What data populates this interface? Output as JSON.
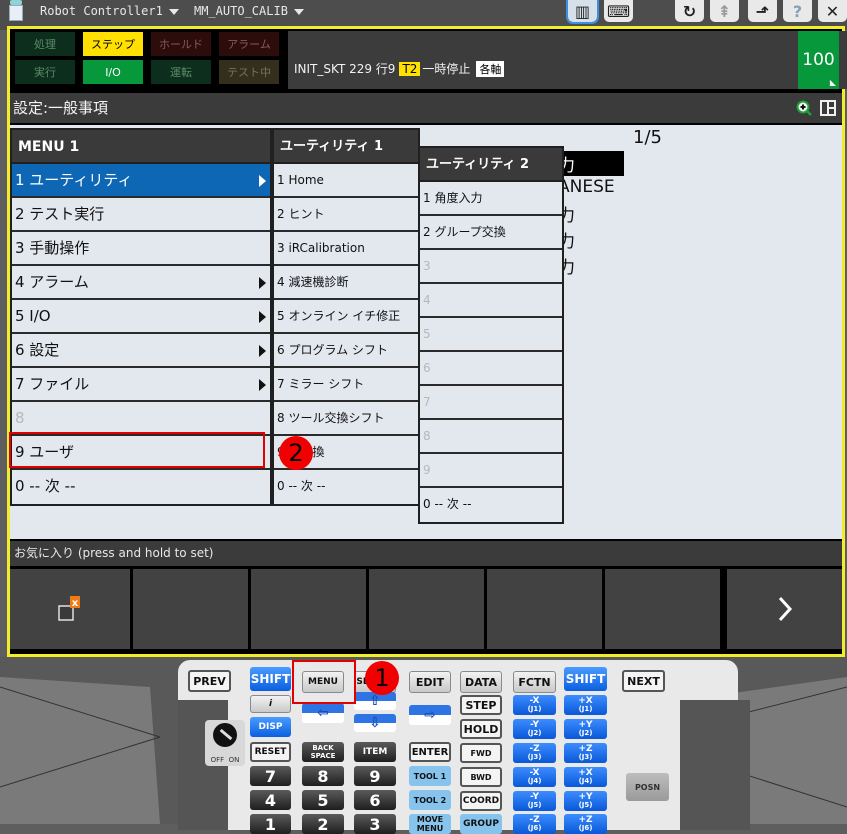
{
  "topbar": {
    "controller_label": "Robot Controller1",
    "program_label": "MM_AUTO_CALIB",
    "buttons": [
      {
        "name": "teach-pendant-view",
        "glyph": "▥",
        "active": true
      },
      {
        "name": "keyboard",
        "glyph": "⌨",
        "active": false
      },
      {
        "name": "refresh",
        "glyph": "↻",
        "active": false
      },
      {
        "name": "collapse",
        "glyph": "⇞",
        "active": false
      },
      {
        "name": "popout",
        "glyph": "⬏",
        "active": false
      },
      {
        "name": "help",
        "glyph": "?",
        "active": false
      },
      {
        "name": "close",
        "glyph": "✕",
        "active": false
      }
    ]
  },
  "status": {
    "indicators": [
      {
        "label": "処理",
        "state": "off-green"
      },
      {
        "label": "ステップ",
        "state": "on-yellow"
      },
      {
        "label": "ホールド",
        "state": "off-red"
      },
      {
        "label": "アラーム",
        "state": "off-red"
      },
      {
        "label": "実行",
        "state": "off-green"
      },
      {
        "label": "I/O",
        "state": "on-green"
      },
      {
        "label": "運転",
        "state": "off-green"
      },
      {
        "label": "テスト中",
        "state": "off-olive"
      }
    ],
    "program": "INIT_SKT 229 行9",
    "tool_frame": "T2",
    "state_text": "一時停止",
    "coord": "各軸",
    "override": "100"
  },
  "screen_title": "設定:一般事項",
  "page_indicator": "1/5",
  "background_rows": [
    "力",
    "ANESE",
    "力",
    "力",
    "力"
  ],
  "menu1": {
    "header": "MENU  1",
    "items": [
      {
        "label": "1 ユーティリティ",
        "submenu": true,
        "selected": true,
        "disabled": false
      },
      {
        "label": "2 テスト実行",
        "submenu": false,
        "selected": false,
        "disabled": false
      },
      {
        "label": "3 手動操作",
        "submenu": false,
        "selected": false,
        "disabled": false
      },
      {
        "label": "4 アラーム",
        "submenu": true,
        "selected": false,
        "disabled": false
      },
      {
        "label": "5 I/O",
        "submenu": true,
        "selected": false,
        "disabled": false
      },
      {
        "label": "6 設定",
        "submenu": true,
        "selected": false,
        "disabled": false
      },
      {
        "label": "7 ファイル",
        "submenu": true,
        "selected": false,
        "disabled": false
      },
      {
        "label": "8",
        "submenu": false,
        "selected": false,
        "disabled": true
      },
      {
        "label": "9 ユーザ",
        "submenu": false,
        "selected": false,
        "disabled": false
      },
      {
        "label": "0 -- 次 --",
        "submenu": false,
        "selected": false,
        "disabled": false
      }
    ]
  },
  "menu2": {
    "header": "ユーティリティ  1",
    "items": [
      {
        "label": "1 Home",
        "disabled": false
      },
      {
        "label": "2 ヒント",
        "disabled": false
      },
      {
        "label": "3 iRCalibration",
        "disabled": false
      },
      {
        "label": "4 減速機診断",
        "disabled": false
      },
      {
        "label": "5 オンライン イチ修正",
        "disabled": false
      },
      {
        "label": "6 プログラム シフト",
        "disabled": false
      },
      {
        "label": "7 ミラー シフト",
        "disabled": false
      },
      {
        "label": "8 ツール交換シフト",
        "disabled": false
      },
      {
        "label": "9 軸交換",
        "disabled": false
      },
      {
        "label": "0 -- 次 --",
        "disabled": false
      }
    ]
  },
  "menu3": {
    "header": "ユーティリティ  2",
    "items": [
      {
        "label": "1 角度入力",
        "disabled": false
      },
      {
        "label": "2 グループ交換",
        "disabled": false
      },
      {
        "label": "3",
        "disabled": true
      },
      {
        "label": "4",
        "disabled": true
      },
      {
        "label": "5",
        "disabled": true
      },
      {
        "label": "6",
        "disabled": true
      },
      {
        "label": "7",
        "disabled": true
      },
      {
        "label": "8",
        "disabled": true
      },
      {
        "label": "9",
        "disabled": true
      },
      {
        "label": "0 -- 次 --",
        "disabled": false
      }
    ]
  },
  "favorites_label": "お気に入り (press and hold to set)",
  "function_keys": [
    "close-window",
    "",
    "",
    "",
    "",
    "",
    "next-page"
  ],
  "annotations": {
    "step1": "1",
    "step2": "2"
  },
  "keypad": {
    "prev": "PREV",
    "shift_left": "SHIFT",
    "menu": "MENU",
    "select": "SELECT",
    "edit": "EDIT",
    "data": "DATA",
    "fctn": "FCTN",
    "shift_right": "SHIFT",
    "next": "NEXT",
    "info": "i",
    "disp": "DISP",
    "reset": "RESET",
    "backspace": "BACK SPACE",
    "item": "ITEM",
    "enter": "ENTER",
    "step": "STEP",
    "hold": "HOLD",
    "fwd": "FWD",
    "bwd": "BWD",
    "coord": "COORD",
    "group": "GROUP",
    "tool1": "TOOL 1",
    "tool2": "TOOL 2",
    "move_menu": "MOVE MENU",
    "digits": [
      "7",
      "8",
      "9",
      "4",
      "5",
      "6",
      "1",
      "2",
      "3"
    ],
    "jog_minus": [
      [
        "-X",
        "(J1)"
      ],
      [
        "-Y",
        "(J2)"
      ],
      [
        "-Z",
        "(J3)"
      ],
      [
        "-X",
        "(J4)"
      ],
      [
        "-Y",
        "(J5)"
      ],
      [
        "-Z",
        "(J6)"
      ]
    ],
    "jog_plus": [
      [
        "+X",
        "(J1)"
      ],
      [
        "+Y",
        "(J2)"
      ],
      [
        "+Z",
        "(J3)"
      ],
      [
        "+X",
        "(J4)"
      ],
      [
        "+Y",
        "(J5)"
      ],
      [
        "+Z",
        "(J6)"
      ]
    ],
    "posn": "POSN",
    "switch_off": "OFF",
    "switch_on": "ON"
  },
  "colors": {
    "highlight_frame": "#f2ec2a",
    "selected_item": "#0e67b5",
    "override_bg": "#07983b",
    "annotation_red": "#e20000",
    "jog_blue": "#0a5fe0"
  }
}
